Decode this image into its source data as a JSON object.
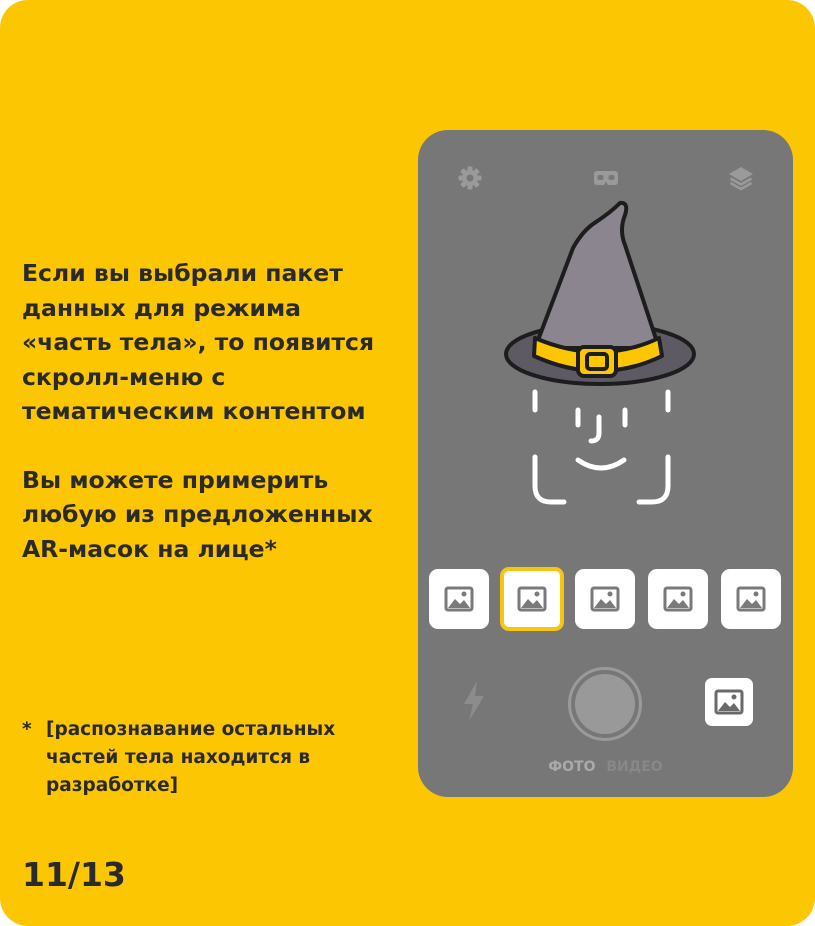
{
  "main_text": {
    "paragraph1_lines": [
      "Если вы выбрали пакет",
      "данных для режима",
      "«часть тела», то появится",
      "скролл-меню с",
      "тематическим контентом"
    ],
    "paragraph2_lines": [
      "Вы можете примерить",
      "любую из предложенных",
      "AR-масок на лице*"
    ]
  },
  "footnote": {
    "star": "*",
    "lines": [
      "[распознавание остальных",
      "частей тела находится в",
      "разработке]"
    ]
  },
  "page_number": "11/13",
  "phone": {
    "top_icons": [
      "gear-icon",
      "vr-glasses-icon",
      "layers-icon"
    ],
    "thumbnails": [
      {
        "icon": "image-icon",
        "selected": false
      },
      {
        "icon": "image-icon",
        "selected": true
      },
      {
        "icon": "image-icon",
        "selected": false
      },
      {
        "icon": "image-icon",
        "selected": false
      },
      {
        "icon": "image-icon",
        "selected": false
      }
    ],
    "modes": {
      "photo": "ФОТО",
      "video": "ВИДЕО"
    }
  },
  "colors": {
    "background": "#FCC602",
    "text": "#2A2A2A",
    "phone": "#777777",
    "selected_border": "#F6C512"
  }
}
